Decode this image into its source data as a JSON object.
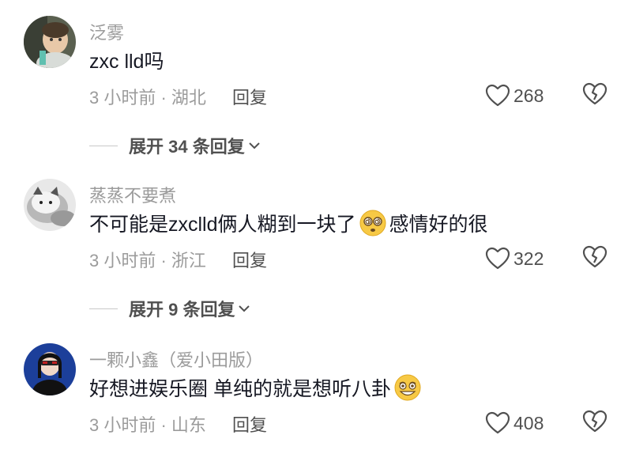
{
  "comments": [
    {
      "username": "泛雾",
      "text_before": "zxc  lld吗",
      "emoji": "",
      "text_after": "",
      "meta": "3 小时前 · 湖北",
      "reply_label": "回复",
      "likes": "268",
      "expand_label": "展开 34 条回复",
      "avatar": "baby-photo"
    },
    {
      "username": "蒸蒸不要煮",
      "text_before": "不可能是zxclld俩人糊到一块了",
      "emoji": "dizzy-face-emoji",
      "text_after": "感情好的很",
      "meta": "3 小时前 · 浙江",
      "reply_label": "回复",
      "likes": "322",
      "expand_label": "展开 9 条回复",
      "avatar": "cat-photo"
    },
    {
      "username": "一颗小鑫（爱小田版）",
      "text_before": "好想进娱乐圈 单纯的就是想听八卦",
      "emoji": "grinning-face-emoji",
      "text_after": "",
      "meta": "3 小时前 · 山东",
      "reply_label": "回复",
      "likes": "408",
      "expand_label": "",
      "avatar": "person-sunglasses-photo"
    }
  ],
  "colors": {
    "text": "#161823",
    "secondary": "#9b9b9b",
    "action": "#505050"
  }
}
